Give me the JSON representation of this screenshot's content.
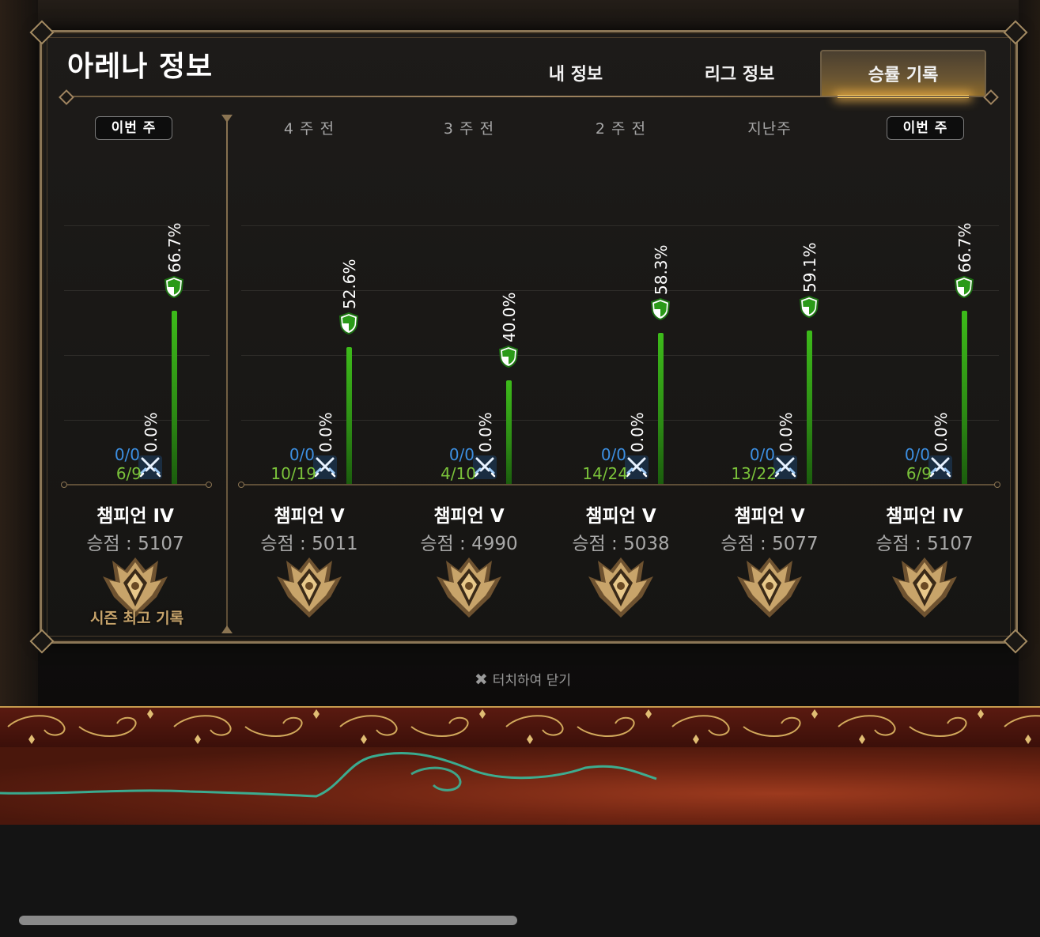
{
  "modal": {
    "title": "아레나 정보",
    "tabs": [
      {
        "label": "내 정보",
        "active": false
      },
      {
        "label": "리그 정보",
        "active": false
      },
      {
        "label": "승률 기록",
        "active": true
      }
    ]
  },
  "best_record": {
    "week_label": "이번 주",
    "tier": "챔피언 IV",
    "score": "승점 : 5107",
    "caption": "시즌 최고 기록",
    "attack_win_rate": 66.7,
    "attack_pct_label": "66.7%",
    "defense_pct_label": "0.0%",
    "defense_record": "0/0",
    "attack_record": "6/9"
  },
  "weeks": [
    {
      "label": "4 주 전",
      "current": false,
      "attack_win_rate": 52.6,
      "attack_pct_label": "52.6%",
      "defense_pct_label": "0.0%",
      "defense_record": "0/0",
      "attack_record": "10/19",
      "tier": "챔피언 V",
      "score": "승점 : 5011"
    },
    {
      "label": "3 주 전",
      "current": false,
      "attack_win_rate": 40.0,
      "attack_pct_label": "40.0%",
      "defense_pct_label": "0.0%",
      "defense_record": "0/0",
      "attack_record": "4/10",
      "tier": "챔피언 V",
      "score": "승점 : 4990"
    },
    {
      "label": "2 주 전",
      "current": false,
      "attack_win_rate": 58.3,
      "attack_pct_label": "58.3%",
      "defense_pct_label": "0.0%",
      "defense_record": "0/0",
      "attack_record": "14/24",
      "tier": "챔피언 V",
      "score": "승점 : 5038"
    },
    {
      "label": "지난주",
      "current": false,
      "attack_win_rate": 59.1,
      "attack_pct_label": "59.1%",
      "defense_pct_label": "0.0%",
      "defense_record": "0/0",
      "attack_record": "13/22",
      "tier": "챔피언 V",
      "score": "승점 : 5077"
    },
    {
      "label": "이번 주",
      "current": true,
      "attack_win_rate": 66.7,
      "attack_pct_label": "66.7%",
      "defense_pct_label": "0.0%",
      "defense_record": "0/0",
      "attack_record": "6/9",
      "tier": "챔피언 IV",
      "score": "승점 : 5107"
    }
  ],
  "close_hint": "터치하여 닫기",
  "icons": {
    "attack": "shield-icon",
    "defense": "crossed-swords-icon",
    "emblem": "champion-emblem-icon",
    "close": "close-icon"
  },
  "colors": {
    "attack_bar": "#3dbb1a",
    "defense_text": "#3c8fe2",
    "attack_text": "#7ac23a",
    "accent_gold": "#ffcf63",
    "frame": "#8b7656"
  }
}
